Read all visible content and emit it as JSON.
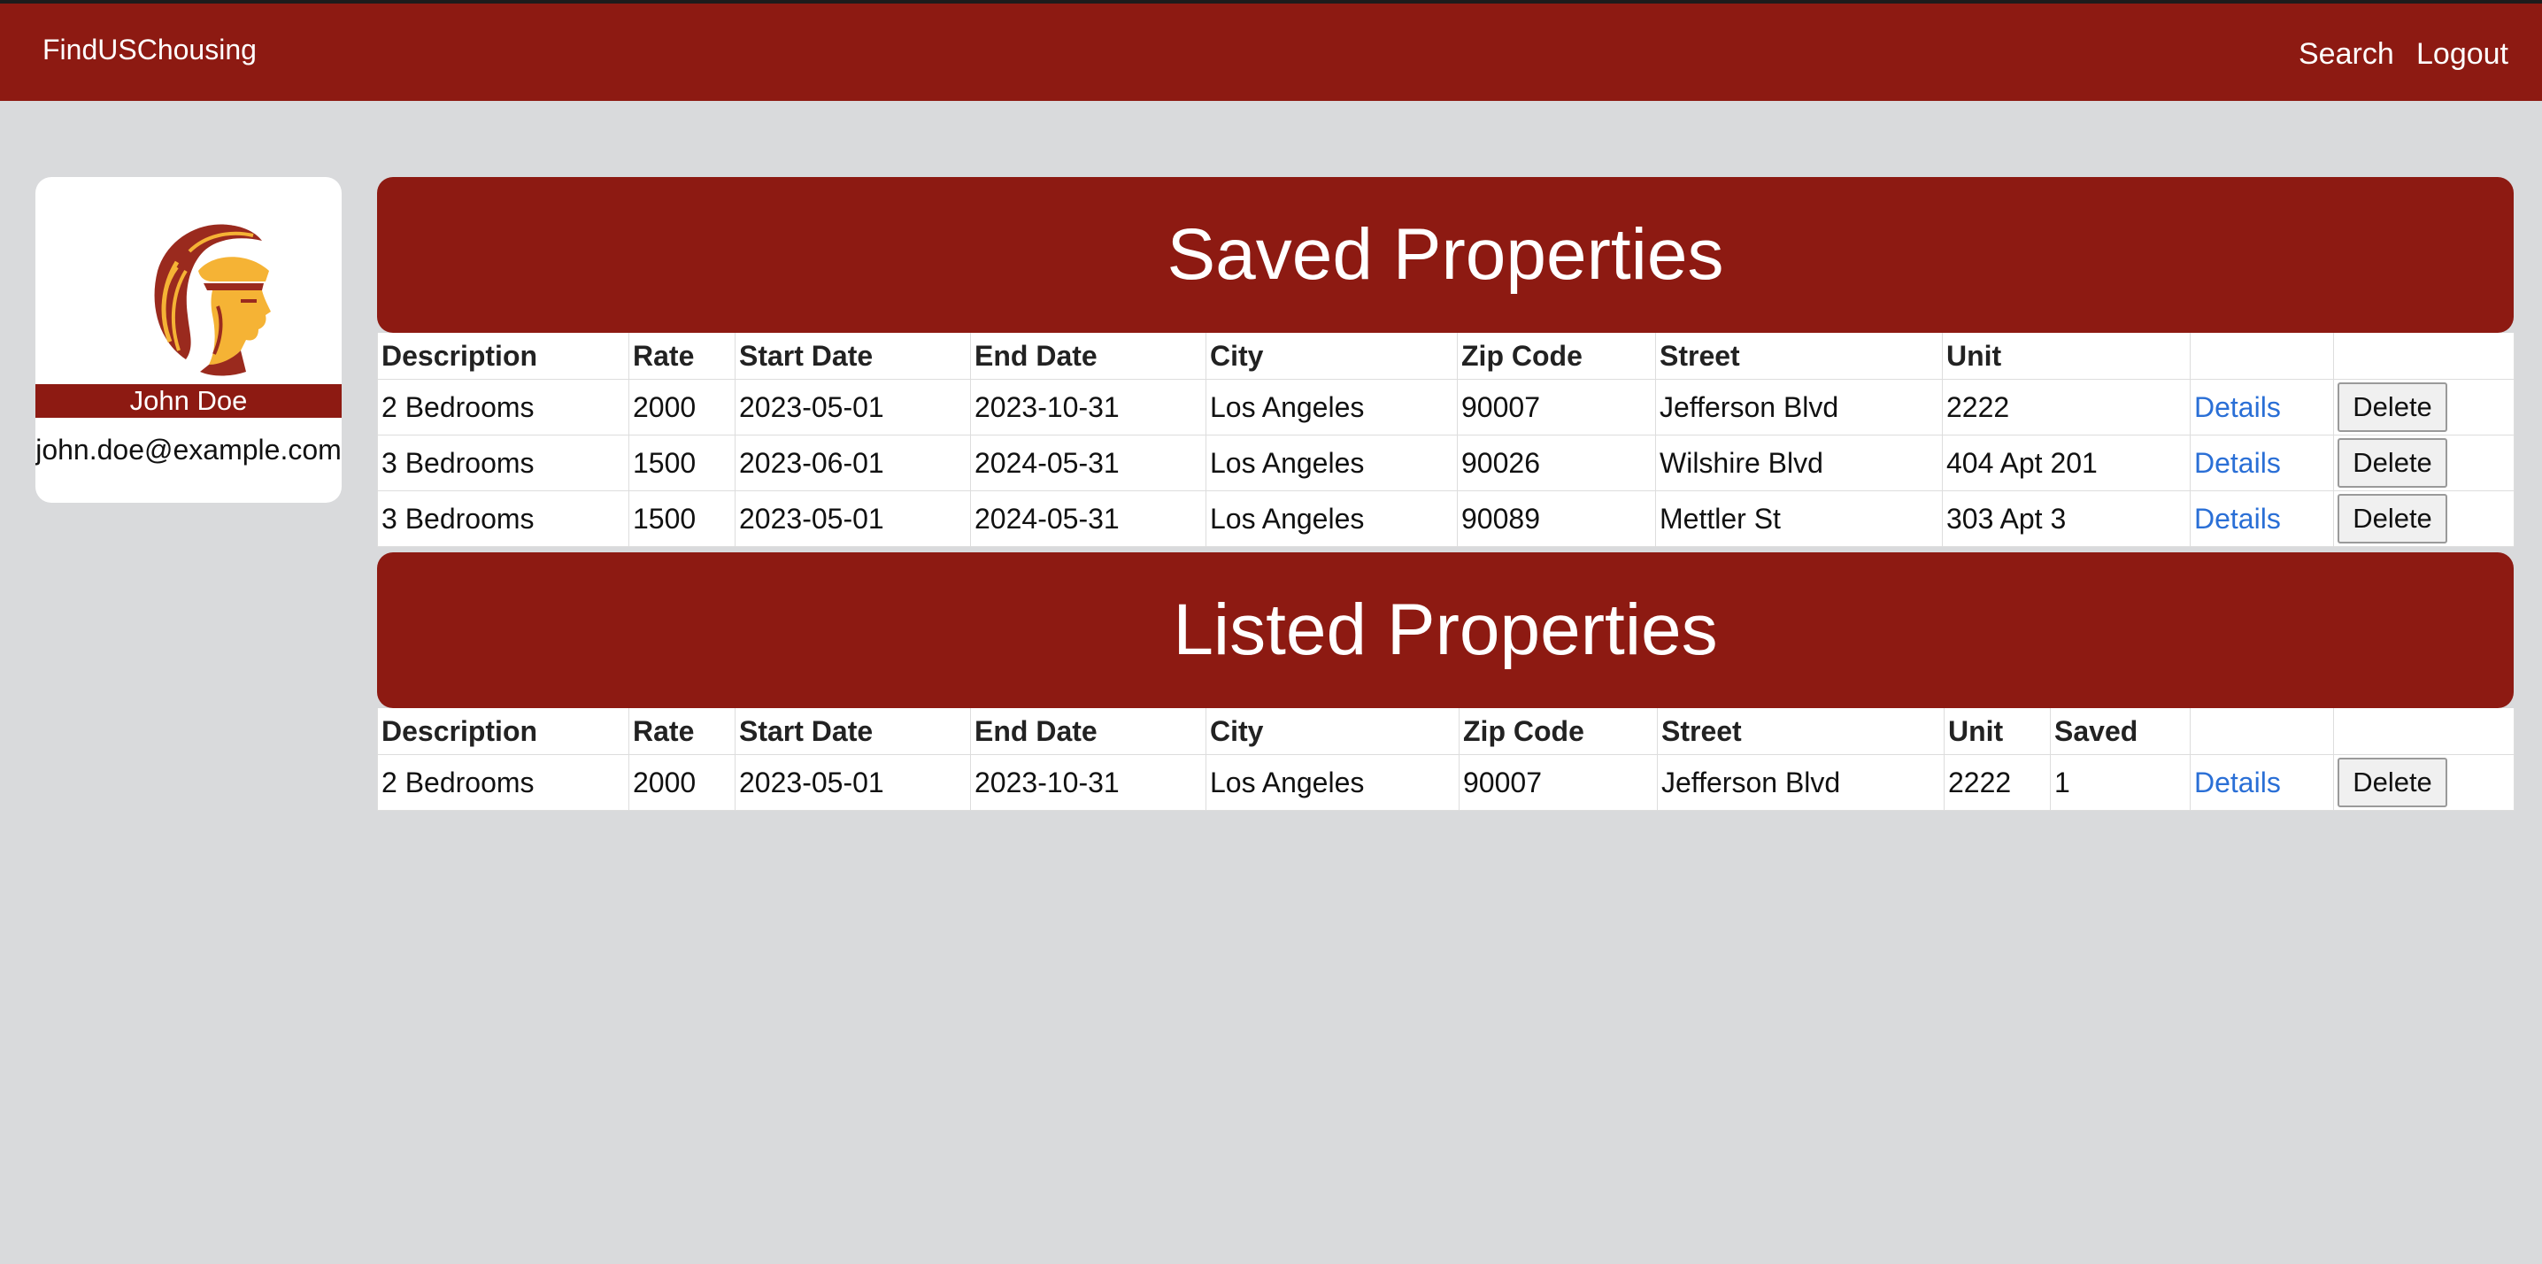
{
  "header": {
    "brand": "FindUSChousing",
    "nav": {
      "search": "Search",
      "logout": "Logout"
    }
  },
  "profile": {
    "logo_icon": "trojan-head-icon",
    "name": "John Doe",
    "email": "john.doe@example.com"
  },
  "colors": {
    "brand": "#8d1a12",
    "gold": "#f5b335",
    "link": "#2a6fd6",
    "page_bg": "#d9dadc"
  },
  "saved": {
    "title": "Saved Properties",
    "columns": [
      "Description",
      "Rate",
      "Start Date",
      "End Date",
      "City",
      "Zip Code",
      "Street",
      "Unit",
      "",
      ""
    ],
    "rows": [
      {
        "description": "2 Bedrooms",
        "rate": "2000",
        "start": "2023-05-01",
        "end": "2023-10-31",
        "city": "Los Angeles",
        "zip": "90007",
        "street": "Jefferson Blvd",
        "unit": "2222",
        "details": "Details",
        "delete": "Delete"
      },
      {
        "description": "3 Bedrooms",
        "rate": "1500",
        "start": "2023-06-01",
        "end": "2024-05-31",
        "city": "Los Angeles",
        "zip": "90026",
        "street": "Wilshire Blvd",
        "unit": "404 Apt 201",
        "details": "Details",
        "delete": "Delete"
      },
      {
        "description": "3 Bedrooms",
        "rate": "1500",
        "start": "2023-05-01",
        "end": "2024-05-31",
        "city": "Los Angeles",
        "zip": "90089",
        "street": "Mettler St",
        "unit": "303 Apt 3",
        "details": "Details",
        "delete": "Delete"
      }
    ]
  },
  "listed": {
    "title": "Listed Properties",
    "columns": [
      "Description",
      "Rate",
      "Start Date",
      "End Date",
      "City",
      "Zip Code",
      "Street",
      "Unit",
      "Saved",
      "",
      ""
    ],
    "rows": [
      {
        "description": "2 Bedrooms",
        "rate": "2000",
        "start": "2023-05-01",
        "end": "2023-10-31",
        "city": "Los Angeles",
        "zip": "90007",
        "street": "Jefferson Blvd",
        "unit": "2222",
        "saved": "1",
        "details": "Details",
        "delete": "Delete"
      }
    ]
  }
}
